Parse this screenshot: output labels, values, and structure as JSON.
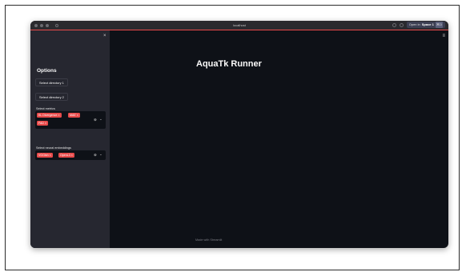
{
  "browser": {
    "url": "localhost",
    "open_in_label": "Open in",
    "space_label": "Space 1",
    "shortcut": "⌘O"
  },
  "sidebar": {
    "close": "×",
    "options_title": "Options",
    "select_dir_1": "Select directory 1",
    "select_dir_2": "Select directory 2",
    "metrics_label": "Select metrics",
    "metrics": [
      {
        "label": "KL Divergence",
        "remove": "×"
      },
      {
        "label": "MAE",
        "remove": "×"
      },
      {
        "label": "FAD",
        "remove": "×"
      }
    ],
    "embeddings_label": "Select neural embeddings",
    "embeddings": [
      {
        "label": "VGGish",
        "remove": "×"
      },
      {
        "label": "OpenL3",
        "remove": "×"
      }
    ],
    "clear_icon": "⊗",
    "dropdown_icon": "⌄"
  },
  "main": {
    "menu": "≡",
    "title": "AquaTk Runner",
    "footer": "Made with Streamlit"
  },
  "colors": {
    "accent": "#e84b4b",
    "sidebar_bg": "#262730",
    "main_bg": "#0e1117"
  }
}
